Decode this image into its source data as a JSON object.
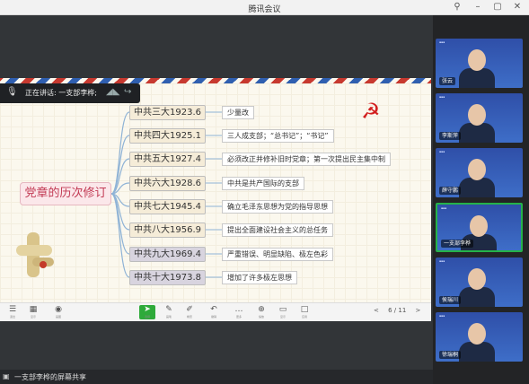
{
  "window": {
    "title": "腾讯会议"
  },
  "speaker": {
    "label": "正在讲话: 一支部李桦;"
  },
  "mindmap": {
    "root": "党章的历次修订",
    "branches": [
      {
        "node": "中共三大1923.6",
        "desc": "少量改",
        "style": "light"
      },
      {
        "node": "中共四大1925.1",
        "desc": "三人成支部；“总书记”；“书记”",
        "style": "light"
      },
      {
        "node": "中共五大1927.4",
        "desc": "必须改正并修补旧时党章；第一次提出民主集中制",
        "style": "light"
      },
      {
        "node": "中共六大1928.6",
        "desc": "中共是共产国际的支部",
        "style": "light"
      },
      {
        "node": "中共七大1945.4",
        "desc": "确立毛泽东思想为党的指导思想",
        "style": "light"
      },
      {
        "node": "中共八大1956.9",
        "desc": "提出全面建设社会主义的总任务",
        "style": "light"
      },
      {
        "node": "中共九大1969.4",
        "desc": "严重错误、明显缺陷、极左色彩",
        "style": "dark"
      },
      {
        "node": "中共十大1973.8",
        "desc": "增加了许多极左思想",
        "style": "dark"
      }
    ]
  },
  "toolbar": {
    "page": "6 / 11",
    "prev": "<",
    "next": ">",
    "tools": [
      {
        "icon": "☰",
        "label": "退出"
      },
      {
        "icon": "▦",
        "label": "显示"
      },
      {
        "icon": "◉",
        "label": "画图"
      },
      {
        "icon": "➤",
        "label": "选择"
      },
      {
        "icon": "✎",
        "label": "画笔"
      },
      {
        "icon": "✐",
        "label": "橡皮"
      },
      {
        "icon": "↶",
        "label": "撤销"
      },
      {
        "icon": "…",
        "label": "更多"
      },
      {
        "icon": "⊕",
        "label": "缩放"
      },
      {
        "icon": "▭",
        "label": "显示"
      },
      {
        "icon": "□",
        "label": "应用"
      }
    ]
  },
  "status": {
    "share_text": "一支部李桦的屏幕共享"
  },
  "participants": [
    {
      "name": "张云"
    },
    {
      "name": "李斯萍"
    },
    {
      "name": "薛守鹏"
    },
    {
      "name": "一支部李桦"
    },
    {
      "name": "侯瑞川"
    },
    {
      "name": "徐瑞桐"
    }
  ],
  "colors": {
    "active_border": "#25b24a",
    "flag": "#d21f1f",
    "root_text": "#c23a54"
  }
}
